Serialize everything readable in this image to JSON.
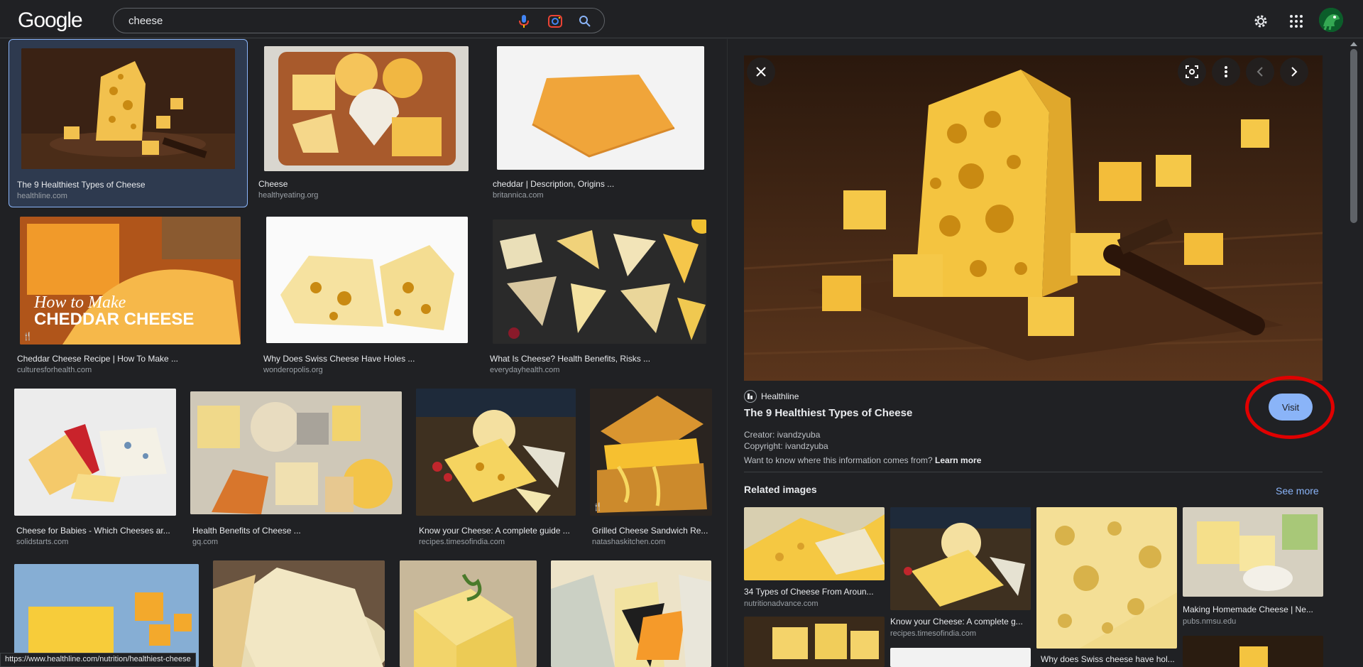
{
  "header": {
    "logo": "Google",
    "search": {
      "value": "cheese"
    }
  },
  "results": [
    {
      "title": "The 9 Healthiest Types of Cheese",
      "source": "healthline.com",
      "selected": true
    },
    {
      "title": "Cheese",
      "source": "healthyeating.org"
    },
    {
      "title": "cheddar | Description, Origins ...",
      "source": "britannica.com"
    },
    {
      "title": "Cheddar Cheese Recipe | How To Make ...",
      "source": "culturesforhealth.com",
      "badge": "recipe-icon",
      "overlay": [
        "How to Make",
        "CHEDDAR CHEESE"
      ]
    },
    {
      "title": "Why Does Swiss Cheese Have Holes ...",
      "source": "wonderopolis.org"
    },
    {
      "title": "What Is Cheese? Health Benefits, Risks ...",
      "source": "everydayhealth.com"
    },
    {
      "title": "Cheese for Babies - Which Cheeses ar...",
      "source": "solidstarts.com"
    },
    {
      "title": "Health Benefits of Cheese ...",
      "source": "gq.com"
    },
    {
      "title": "Know your Cheese: A complete guide ...",
      "source": "recipes.timesofindia.com"
    },
    {
      "title": "Grilled Cheese Sandwich Re...",
      "source": "natashaskitchen.com",
      "badge": "recipe-icon"
    }
  ],
  "panel": {
    "source_name": "Healthline",
    "title": "The 9 Healthiest Types of Cheese",
    "visit_label": "Visit",
    "creator": "Creator: ivandzyuba",
    "copyright": "Copyright: ivandzyuba",
    "info_text": "Want to know where this information comes from?",
    "learn_more": "Learn more",
    "related_heading": "Related images",
    "see_more": "See more",
    "related": [
      {
        "title": "34 Types of Cheese From Aroun...",
        "source": "nutritionadvance.com"
      },
      {
        "title": "Know your Cheese: A complete g...",
        "source": "recipes.timesofindia.com"
      },
      {
        "title": "Why does Swiss cheese have hol...",
        "source": ""
      },
      {
        "title": "Making Homemade Cheese | Ne...",
        "source": "pubs.nmsu.edu"
      }
    ]
  },
  "status_url": "https://www.healthline.com/nutrition/healthiest-cheese",
  "colors": {
    "accent": "#8ab4f8",
    "background": "#202124",
    "highlight_ring": "#e00000"
  }
}
